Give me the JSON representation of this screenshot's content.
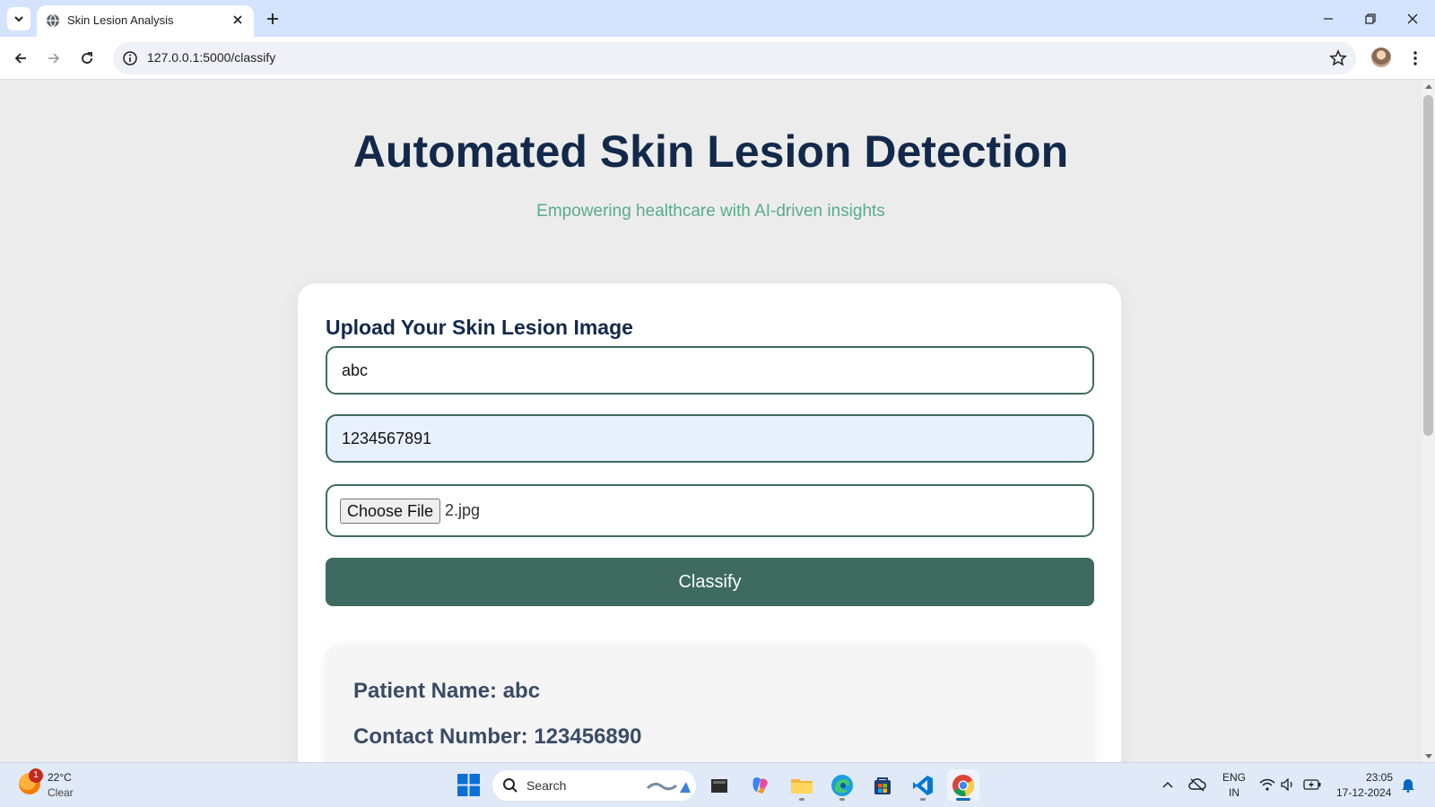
{
  "browser": {
    "tab_title": "Skin Lesion Analysis",
    "url": "127.0.0.1:5000/classify"
  },
  "page": {
    "title": "Automated Skin Lesion Detection",
    "subtitle": "Empowering healthcare with AI-driven insights",
    "form": {
      "heading": "Upload Your Skin Lesion Image",
      "name_value": "abc",
      "phone_value": "1234567891",
      "file_button": "Choose File",
      "file_name": "2.jpg",
      "submit_label": "Classify"
    },
    "result": {
      "patient_name": "Patient Name: abc",
      "contact_number": "Contact Number: 123456890"
    }
  },
  "taskbar": {
    "weather_temp": "22°C",
    "weather_condition": "Clear",
    "weather_badge": "1",
    "search_label": "Search",
    "lang_line1": "ENG",
    "lang_line2": "IN",
    "time": "23:05",
    "date": "17-12-2024"
  },
  "colors": {
    "heading": "#13294b",
    "subtitle": "#5aab8e",
    "accent": "#3e6a60",
    "page_bg": "#ececec",
    "autofill_bg": "#e8f0fe"
  },
  "icons": {
    "taskbar_apps": [
      "file-explorer-icon",
      "copilot-icon",
      "folder-icon",
      "edge-icon",
      "store-icon",
      "vscode-icon",
      "chrome-icon"
    ]
  }
}
